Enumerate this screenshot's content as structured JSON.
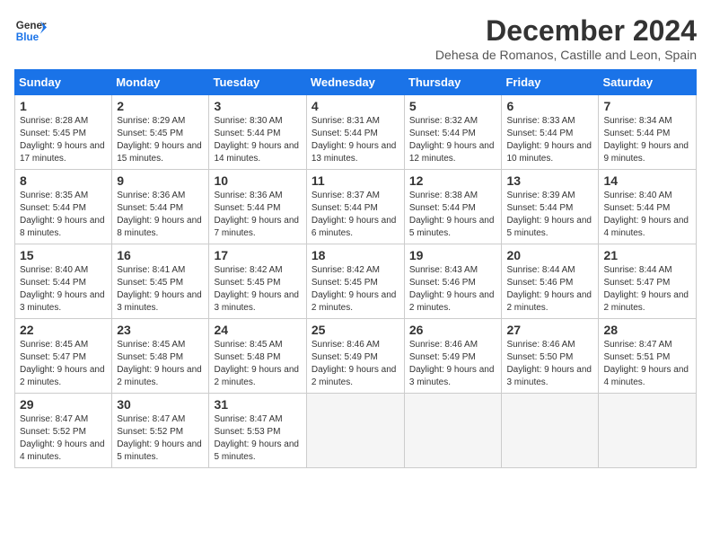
{
  "header": {
    "logo_text_general": "General",
    "logo_text_blue": "Blue",
    "main_title": "December 2024",
    "subtitle": "Dehesa de Romanos, Castille and Leon, Spain"
  },
  "calendar": {
    "days_of_week": [
      "Sunday",
      "Monday",
      "Tuesday",
      "Wednesday",
      "Thursday",
      "Friday",
      "Saturday"
    ],
    "weeks": [
      [
        {
          "day": "",
          "empty": true
        },
        {
          "day": "",
          "empty": true
        },
        {
          "day": "",
          "empty": true
        },
        {
          "day": "",
          "empty": true
        },
        {
          "day": "",
          "empty": true
        },
        {
          "day": "",
          "empty": true
        },
        {
          "day": "",
          "empty": true
        }
      ]
    ],
    "cells": [
      {
        "date": "1",
        "sunrise": "8:28 AM",
        "sunset": "5:45 PM",
        "daylight": "9 hours and 17 minutes."
      },
      {
        "date": "2",
        "sunrise": "8:29 AM",
        "sunset": "5:45 PM",
        "daylight": "9 hours and 15 minutes."
      },
      {
        "date": "3",
        "sunrise": "8:30 AM",
        "sunset": "5:44 PM",
        "daylight": "9 hours and 14 minutes."
      },
      {
        "date": "4",
        "sunrise": "8:31 AM",
        "sunset": "5:44 PM",
        "daylight": "9 hours and 13 minutes."
      },
      {
        "date": "5",
        "sunrise": "8:32 AM",
        "sunset": "5:44 PM",
        "daylight": "9 hours and 12 minutes."
      },
      {
        "date": "6",
        "sunrise": "8:33 AM",
        "sunset": "5:44 PM",
        "daylight": "9 hours and 10 minutes."
      },
      {
        "date": "7",
        "sunrise": "8:34 AM",
        "sunset": "5:44 PM",
        "daylight": "9 hours and 9 minutes."
      },
      {
        "date": "8",
        "sunrise": "8:35 AM",
        "sunset": "5:44 PM",
        "daylight": "9 hours and 8 minutes."
      },
      {
        "date": "9",
        "sunrise": "8:36 AM",
        "sunset": "5:44 PM",
        "daylight": "9 hours and 8 minutes."
      },
      {
        "date": "10",
        "sunrise": "8:36 AM",
        "sunset": "5:44 PM",
        "daylight": "9 hours and 7 minutes."
      },
      {
        "date": "11",
        "sunrise": "8:37 AM",
        "sunset": "5:44 PM",
        "daylight": "9 hours and 6 minutes."
      },
      {
        "date": "12",
        "sunrise": "8:38 AM",
        "sunset": "5:44 PM",
        "daylight": "9 hours and 5 minutes."
      },
      {
        "date": "13",
        "sunrise": "8:39 AM",
        "sunset": "5:44 PM",
        "daylight": "9 hours and 5 minutes."
      },
      {
        "date": "14",
        "sunrise": "8:40 AM",
        "sunset": "5:44 PM",
        "daylight": "9 hours and 4 minutes."
      },
      {
        "date": "15",
        "sunrise": "8:40 AM",
        "sunset": "5:44 PM",
        "daylight": "9 hours and 3 minutes."
      },
      {
        "date": "16",
        "sunrise": "8:41 AM",
        "sunset": "5:45 PM",
        "daylight": "9 hours and 3 minutes."
      },
      {
        "date": "17",
        "sunrise": "8:42 AM",
        "sunset": "5:45 PM",
        "daylight": "9 hours and 3 minutes."
      },
      {
        "date": "18",
        "sunrise": "8:42 AM",
        "sunset": "5:45 PM",
        "daylight": "9 hours and 2 minutes."
      },
      {
        "date": "19",
        "sunrise": "8:43 AM",
        "sunset": "5:46 PM",
        "daylight": "9 hours and 2 minutes."
      },
      {
        "date": "20",
        "sunrise": "8:44 AM",
        "sunset": "5:46 PM",
        "daylight": "9 hours and 2 minutes."
      },
      {
        "date": "21",
        "sunrise": "8:44 AM",
        "sunset": "5:47 PM",
        "daylight": "9 hours and 2 minutes."
      },
      {
        "date": "22",
        "sunrise": "8:45 AM",
        "sunset": "5:47 PM",
        "daylight": "9 hours and 2 minutes."
      },
      {
        "date": "23",
        "sunrise": "8:45 AM",
        "sunset": "5:48 PM",
        "daylight": "9 hours and 2 minutes."
      },
      {
        "date": "24",
        "sunrise": "8:45 AM",
        "sunset": "5:48 PM",
        "daylight": "9 hours and 2 minutes."
      },
      {
        "date": "25",
        "sunrise": "8:46 AM",
        "sunset": "5:49 PM",
        "daylight": "9 hours and 2 minutes."
      },
      {
        "date": "26",
        "sunrise": "8:46 AM",
        "sunset": "5:49 PM",
        "daylight": "9 hours and 3 minutes."
      },
      {
        "date": "27",
        "sunrise": "8:46 AM",
        "sunset": "5:50 PM",
        "daylight": "9 hours and 3 minutes."
      },
      {
        "date": "28",
        "sunrise": "8:47 AM",
        "sunset": "5:51 PM",
        "daylight": "9 hours and 4 minutes."
      },
      {
        "date": "29",
        "sunrise": "8:47 AM",
        "sunset": "5:52 PM",
        "daylight": "9 hours and 4 minutes."
      },
      {
        "date": "30",
        "sunrise": "8:47 AM",
        "sunset": "5:52 PM",
        "daylight": "9 hours and 5 minutes."
      },
      {
        "date": "31",
        "sunrise": "8:47 AM",
        "sunset": "5:53 PM",
        "daylight": "9 hours and 5 minutes."
      }
    ]
  }
}
